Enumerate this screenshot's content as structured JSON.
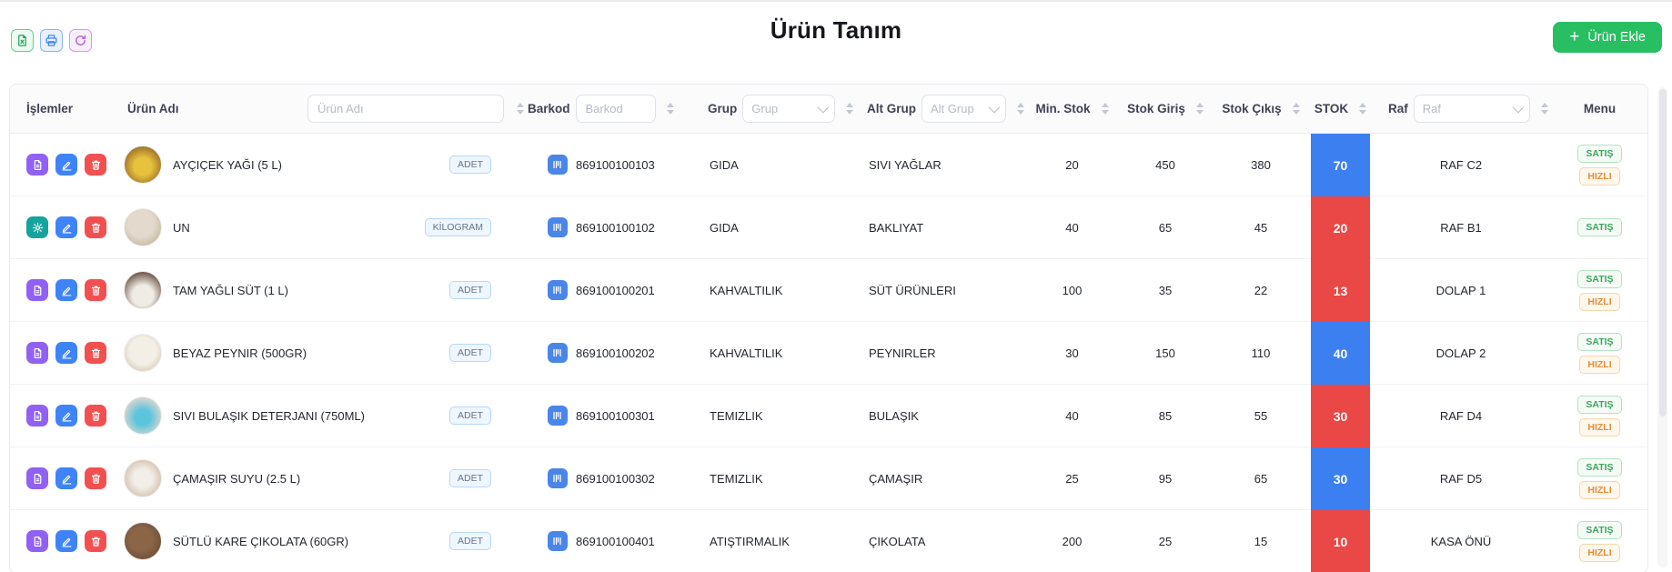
{
  "header": {
    "title": "Ürün Tanım",
    "add_button": {
      "plus": "+",
      "label": "Ürün Ekle"
    },
    "toolbar": [
      {
        "name": "export-excel-button",
        "icon": "excel-file-icon",
        "style": "green"
      },
      {
        "name": "print-button",
        "icon": "printer-icon",
        "style": "blue"
      },
      {
        "name": "refresh-button",
        "icon": "refresh-icon",
        "style": "purple"
      }
    ]
  },
  "table": {
    "columns": {
      "islemler": {
        "label": "İşlemler"
      },
      "urun_adi": {
        "label": "Ürün Adı",
        "filter_placeholder": "Ürün Adı"
      },
      "barkod": {
        "label": "Barkod",
        "filter_placeholder": "Barkod"
      },
      "grup": {
        "label": "Grup",
        "filter_placeholder": "Grup"
      },
      "alt_grup": {
        "label": "Alt Grup",
        "filter_placeholder": "Alt Grup"
      },
      "min_stok": {
        "label": "Min. Stok"
      },
      "stok_giris": {
        "label": "Stok Giriş"
      },
      "stok_cikis": {
        "label": "Stok Çıkış"
      },
      "stok": {
        "label": "STOK"
      },
      "raf": {
        "label": "Raf",
        "filter_placeholder": "Raf"
      },
      "menu": {
        "label": "Menu"
      }
    },
    "rows": [
      {
        "actions": [
          "file",
          "edit",
          "delete"
        ],
        "image": "oil",
        "name": "AYÇIÇEK YAĞI (5 L)",
        "unit": "ADET",
        "barcode": "869100100103",
        "grup": "GIDA",
        "alt_grup": "SIVI YAĞLAR",
        "min_stok": "20",
        "stok_giris": "450",
        "stok_cikis": "380",
        "stok": "70",
        "stok_state": "ok",
        "raf": "RAF C2",
        "badges": [
          {
            "label": "SATIŞ",
            "style": "success"
          },
          {
            "label": "HIZLI",
            "style": "warning"
          }
        ]
      },
      {
        "actions": [
          "gear",
          "edit",
          "delete"
        ],
        "image": "flour",
        "name": "UN",
        "unit": "KİLOGRAM",
        "barcode": "869100100102",
        "grup": "GIDA",
        "alt_grup": "BAKLIYAT",
        "min_stok": "40",
        "stok_giris": "65",
        "stok_cikis": "45",
        "stok": "20",
        "stok_state": "low",
        "raf": "RAF B1",
        "badges": [
          {
            "label": "SATIŞ",
            "style": "success"
          }
        ]
      },
      {
        "actions": [
          "file",
          "edit",
          "delete"
        ],
        "image": "milk",
        "name": "TAM YAĞLI SÜT (1 L)",
        "unit": "ADET",
        "barcode": "869100100201",
        "grup": "KAHVALTILIK",
        "alt_grup": "SÜT ÜRÜNLERI",
        "min_stok": "100",
        "stok_giris": "35",
        "stok_cikis": "22",
        "stok": "13",
        "stok_state": "low",
        "raf": "DOLAP 1",
        "badges": [
          {
            "label": "SATIŞ",
            "style": "success"
          },
          {
            "label": "HIZLI",
            "style": "warning"
          }
        ]
      },
      {
        "actions": [
          "file",
          "edit",
          "delete"
        ],
        "image": "cheese",
        "name": "BEYAZ PEYNIR (500GR)",
        "unit": "ADET",
        "barcode": "869100100202",
        "grup": "KAHVALTILIK",
        "alt_grup": "PEYNIRLER",
        "min_stok": "30",
        "stok_giris": "150",
        "stok_cikis": "110",
        "stok": "40",
        "stok_state": "ok",
        "raf": "DOLAP 2",
        "badges": [
          {
            "label": "SATIŞ",
            "style": "success"
          },
          {
            "label": "HIZLI",
            "style": "warning"
          }
        ]
      },
      {
        "actions": [
          "file",
          "edit",
          "delete"
        ],
        "image": "detergent",
        "name": "SIVI BULAŞIK DETERJANI (750ML)",
        "unit": "ADET",
        "barcode": "869100100301",
        "grup": "TEMIZLIK",
        "alt_grup": "BULAŞIK",
        "min_stok": "40",
        "stok_giris": "85",
        "stok_cikis": "55",
        "stok": "30",
        "stok_state": "low",
        "raf": "RAF D4",
        "badges": [
          {
            "label": "SATIŞ",
            "style": "success"
          },
          {
            "label": "HIZLI",
            "style": "warning"
          }
        ]
      },
      {
        "actions": [
          "file",
          "edit",
          "delete"
        ],
        "image": "bleach",
        "name": "ÇAMAŞIR SUYU (2.5 L)",
        "unit": "ADET",
        "barcode": "869100100302",
        "grup": "TEMIZLIK",
        "alt_grup": "ÇAMAŞIR",
        "min_stok": "25",
        "stok_giris": "95",
        "stok_cikis": "65",
        "stok": "30",
        "stok_state": "ok",
        "raf": "RAF D5",
        "badges": [
          {
            "label": "SATIŞ",
            "style": "success"
          },
          {
            "label": "HIZLI",
            "style": "warning"
          }
        ]
      },
      {
        "actions": [
          "file",
          "edit",
          "delete"
        ],
        "image": "chocolate",
        "name": "SÜTLÜ KARE ÇIKOLATA (60GR)",
        "unit": "ADET",
        "barcode": "869100100401",
        "grup": "ATIŞTIRMALIK",
        "alt_grup": "ÇIKOLATA",
        "min_stok": "200",
        "stok_giris": "25",
        "stok_cikis": "15",
        "stok": "10",
        "stok_state": "low",
        "raf": "KASA ÖNÜ",
        "badges": [
          {
            "label": "SATIŞ",
            "style": "success"
          },
          {
            "label": "HIZLI",
            "style": "warning"
          }
        ]
      }
    ]
  },
  "colors": {
    "stok_ok": "#3c7ff1",
    "stok_low": "#ea4747",
    "accent_green": "#28bf63",
    "action_purple": "#9161f3",
    "action_blue": "#3f83f8",
    "action_red": "#f25050",
    "action_teal": "#16a39d"
  }
}
